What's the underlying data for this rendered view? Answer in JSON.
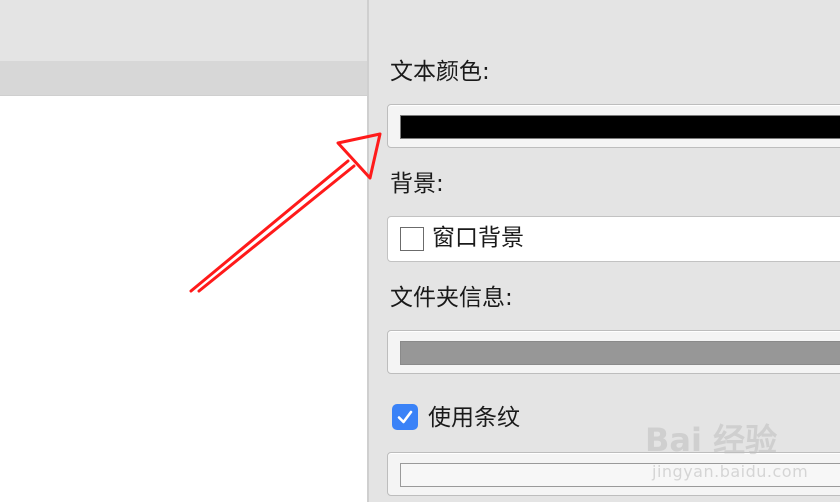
{
  "settings": {
    "text_color_label": "文本颜色:",
    "text_color": "#000000",
    "background_label": "背景:",
    "background_value": "窗口背景",
    "folder_info_label": "文件夹信息:",
    "folder_info_color": "#979797",
    "stripes_label": "使用条纹",
    "stripes_checked": true,
    "stripe_color": "#f7f7f7"
  },
  "accent_color": "#3a82f7",
  "annotation_color": "#ff0000",
  "watermark": {
    "logo": "Bai 经验",
    "url": "jingyan.baidu.com"
  }
}
